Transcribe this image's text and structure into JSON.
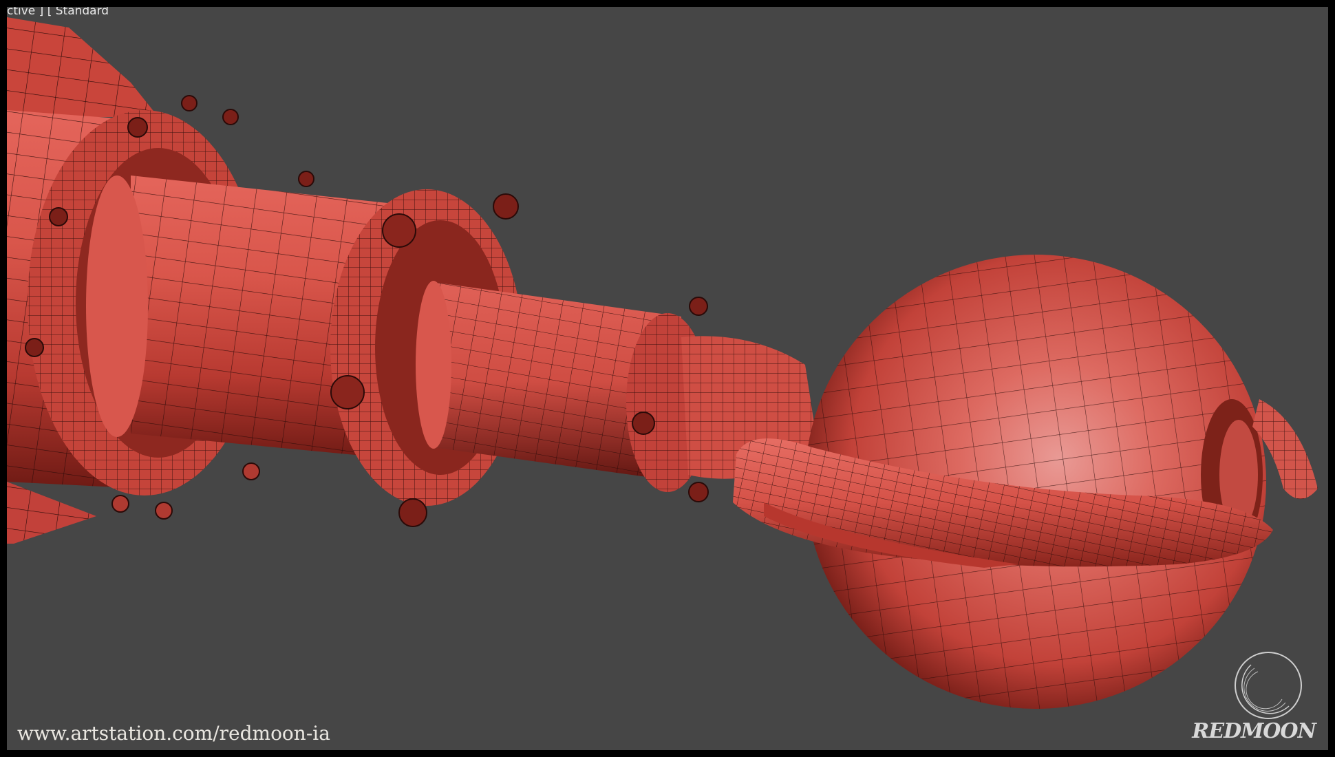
{
  "viewport": {
    "label": "ctive ] [ Standard",
    "background": "#464646"
  },
  "model": {
    "name_icon": "3d-red-mesh",
    "surface_color": "#d2483e",
    "wire_color": "#2a0a08"
  },
  "watermark": {
    "url": "www.artstation.com/redmoon-ia",
    "logo_text": "REDMOON",
    "logo_icon": "crescent-moon-logo"
  }
}
